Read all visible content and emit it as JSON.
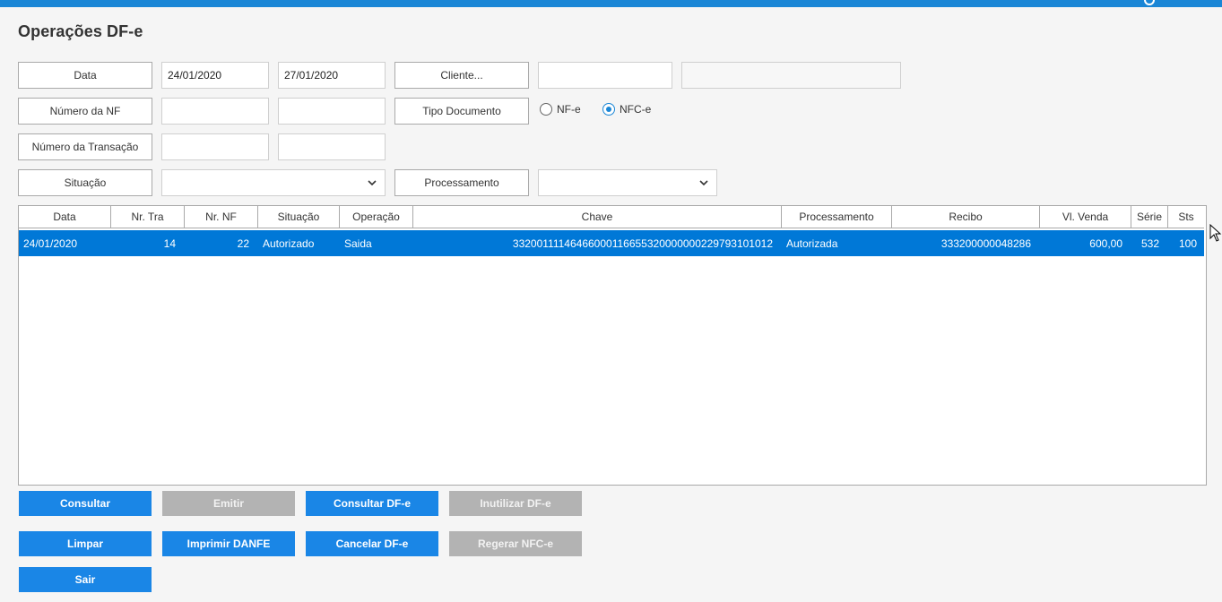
{
  "page": {
    "title": "Operações DF-e"
  },
  "topbar": {
    "icon": "power-icon"
  },
  "filters": {
    "data_label": "Data",
    "data_from": "24/01/2020",
    "data_to": "27/01/2020",
    "cliente_label": "Cliente...",
    "cliente_code": "",
    "cliente_name": "",
    "numero_nf_label": "Número da NF",
    "numero_nf_from": "",
    "numero_nf_to": "",
    "tipo_documento_label": "Tipo Documento",
    "tipo_options": [
      {
        "label": "NF-e",
        "checked": false
      },
      {
        "label": "NFC-e",
        "checked": true
      }
    ],
    "numero_transacao_label": "Número da Transação",
    "numero_transacao_from": "",
    "numero_transacao_to": "",
    "situacao_label": "Situação",
    "situacao_value": "",
    "processamento_label": "Processamento",
    "processamento_value": ""
  },
  "grid": {
    "columns": [
      "Data",
      "Nr. Tra",
      "Nr. NF",
      "Situação",
      "Operação",
      "Chave",
      "Processamento",
      "Recibo",
      "Vl. Venda",
      "Série",
      "Sts"
    ],
    "rows": [
      [
        "24/01/2020",
        "14",
        "22",
        "Autorizado",
        "Saida",
        "33200111146466000116655320000000229793101012",
        "Autorizada",
        "333200000048286",
        "600,00",
        "532",
        "100"
      ]
    ]
  },
  "buttons": {
    "consultar": "Consultar",
    "emitir": "Emitir",
    "consultar_dfe": "Consultar DF-e",
    "inutilizar_dfe": "Inutilizar DF-e",
    "limpar": "Limpar",
    "imprimir_danfe": "Imprimir DANFE",
    "cancelar_dfe": "Cancelar DF-e",
    "regerar_nfce": "Regerar NFC-e",
    "sair": "Sair"
  },
  "colors": {
    "accent": "#1a86e6",
    "selection": "#0078d7",
    "disabled": "#b3b3b3",
    "topbar": "#1a86d6"
  }
}
